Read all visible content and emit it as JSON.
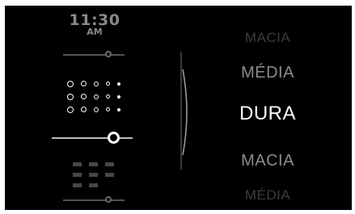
{
  "clock": {
    "time": "11:30",
    "ampm": "AM"
  },
  "icons": {
    "top_slider": "slider-icon",
    "dots_pattern": "dot-pattern-icon",
    "bottom_grid": "grid-pattern-icon",
    "bottom_slider": "slider-icon"
  },
  "main_slider": {
    "level": 0.76
  },
  "picker": {
    "items": [
      "MACIA",
      "MÉDIA",
      "DURA",
      "MACIA",
      "MÉDIA"
    ],
    "selected_index": 2
  },
  "colors": {
    "background": "#000000",
    "selected_text": "#ffffff",
    "dim_text": "#8c8c8c",
    "faint_text": "#3c3c3c"
  }
}
